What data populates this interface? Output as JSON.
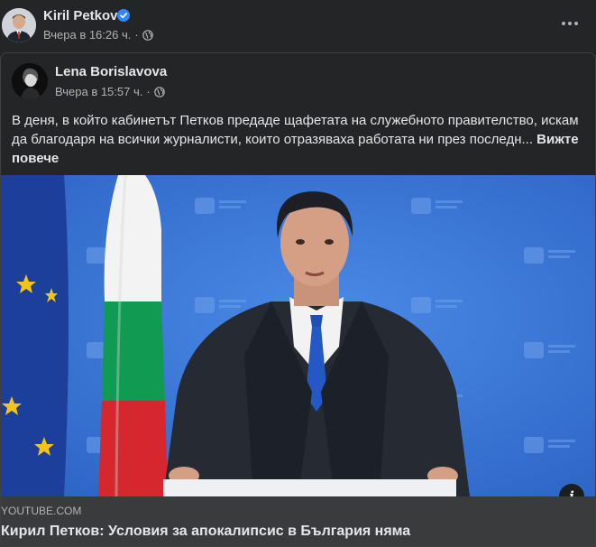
{
  "post": {
    "author": "Kiril Petkov",
    "timestamp": "Вчера в 16:26 ч.",
    "separator": "·",
    "privacy_icon": "globe-icon",
    "verified_icon": "verified-badge-icon",
    "more_icon": "more-options-icon"
  },
  "shared_post": {
    "author": "Lena Borislavova",
    "timestamp": "Вчера в 15:57 ч.",
    "separator": "·",
    "privacy_icon": "globe-icon",
    "text": "В деня, в който кабинетът Петков предаде щафетата на служебното правителство, искам да благодаря на всички журналисти, които отразяваха работата ни през последн...",
    "see_more": "Вижте повече"
  },
  "link_preview": {
    "domain": "YOUTUBE.COM",
    "title": "Кирил Петков: Условия за апокалипсис в България няма",
    "info_label": "i"
  },
  "colors": {
    "background": "#242526",
    "card": "#3a3b3c",
    "text_primary": "#e4e6eb",
    "text_secondary": "#b0b3b8",
    "verified": "#2d88ff",
    "media_backdrop": "#3a77d6"
  }
}
